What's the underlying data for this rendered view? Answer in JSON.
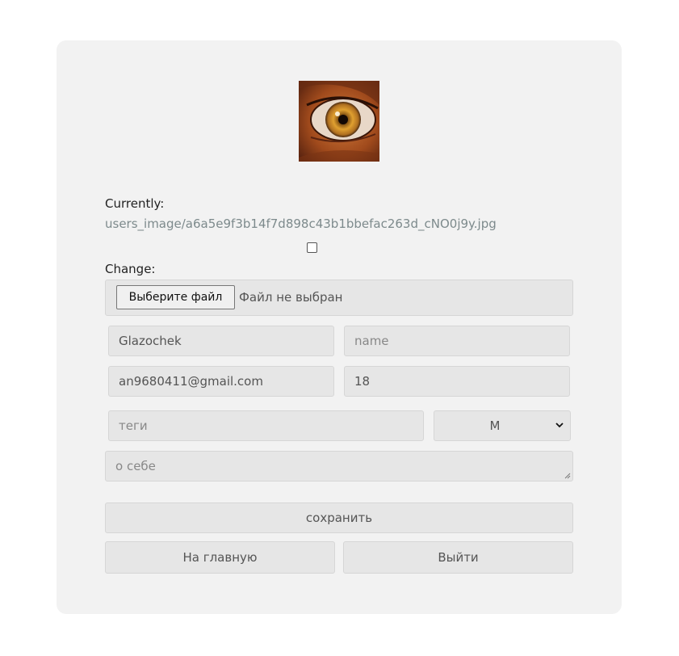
{
  "profile": {
    "currently_label": "Currently:",
    "current_file": "users_image/a6a5e9f3b14f7d898c43b1bbefac263d_cNO0j9y.jpg",
    "change_label": "Change:",
    "file_button_label": "Выберите файл",
    "file_status": "Файл не выбран"
  },
  "form": {
    "username_value": "Glazochek",
    "name_placeholder": "name",
    "email_value": "an9680411@gmail.com",
    "age_value": "18",
    "tags_placeholder": "теги",
    "gender_selected": "M",
    "about_placeholder": "о себе"
  },
  "buttons": {
    "save_label": "сохранить",
    "home_label": "На главную",
    "logout_label": "Выйти"
  },
  "colors": {
    "card_background": "#f2f2f2",
    "field_background": "#e6e6e6",
    "link_color": "#7d8a8c"
  }
}
